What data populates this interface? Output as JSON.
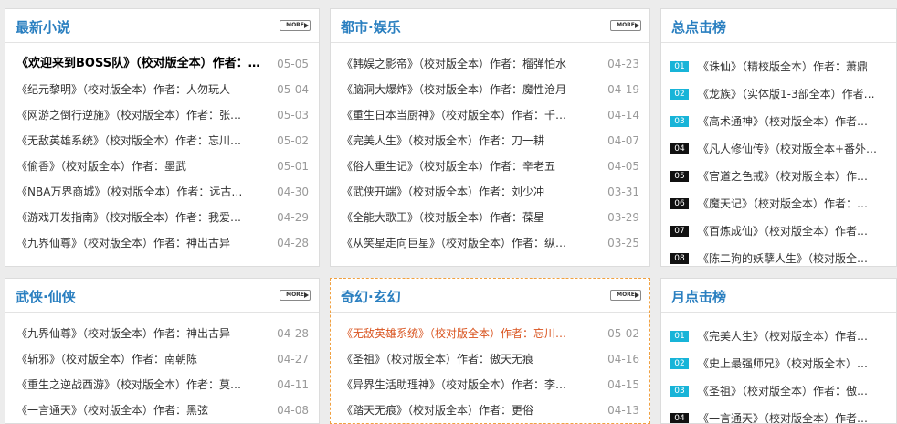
{
  "more_label": "MORE",
  "latest": {
    "title": "最新小说",
    "items": [
      {
        "text": "《欢迎来到BOSS队》（校对版全本）作者：…",
        "date": "05-05"
      },
      {
        "text": "《纪元黎明》（校对版全本）作者：人勿玩人",
        "date": "05-04"
      },
      {
        "text": "《网游之倒行逆施》（校对版全本）作者：张…",
        "date": "05-03"
      },
      {
        "text": "《无敌英雄系统》（校对版全本）作者：忘川…",
        "date": "05-02"
      },
      {
        "text": "《偷香》（校对版全本）作者：墨武",
        "date": "05-01"
      },
      {
        "text": "《NBA万界商城》（校对版全本）作者：远古…",
        "date": "04-30"
      },
      {
        "text": "《游戏开发指南》（校对版全本）作者：我爱…",
        "date": "04-29"
      },
      {
        "text": "《九界仙尊》（校对版全本）作者：神出古异",
        "date": "04-28"
      }
    ]
  },
  "urban": {
    "title": "都市·娱乐",
    "items": [
      {
        "text": "《韩娱之影帝》（校对版全本）作者：榴弹怕水",
        "date": "04-23"
      },
      {
        "text": "《脑洞大爆炸》（校对版全本）作者：魔性沧月",
        "date": "04-19"
      },
      {
        "text": "《重生日本当厨神》（校对版全本）作者：千…",
        "date": "04-14"
      },
      {
        "text": "《完美人生》（校对版全本）作者：刀一耕",
        "date": "04-07"
      },
      {
        "text": "《俗人重生记》（校对版全本）作者：辛老五",
        "date": "04-05"
      },
      {
        "text": "《武侠开端》（校对版全本）作者：刘少冲",
        "date": "03-31"
      },
      {
        "text": "《全能大歌王》（校对版全本）作者：葆星",
        "date": "03-29"
      },
      {
        "text": "《从笑星走向巨星》（校对版全本）作者：纵…",
        "date": "03-25"
      }
    ]
  },
  "total": {
    "title": "总点击榜",
    "items": [
      {
        "rank": "01",
        "text": "《诛仙》（精校版全本）作者：萧鼎"
      },
      {
        "rank": "02",
        "text": "《龙族》（实体版1-3部全本）作者…"
      },
      {
        "rank": "03",
        "text": "《高术通神》（校对版全本）作者…"
      },
      {
        "rank": "04",
        "text": "《凡人修仙传》（校对版全本+番外…"
      },
      {
        "rank": "05",
        "text": "《官道之色戒》（校对版全本）作…"
      },
      {
        "rank": "06",
        "text": "《魔天记》（校对版全本）作者：…"
      },
      {
        "rank": "07",
        "text": "《百炼成仙》（校对版全本）作者…"
      },
      {
        "rank": "08",
        "text": "《陈二狗的妖孽人生》（校对版全…"
      }
    ]
  },
  "wuxia": {
    "title": "武侠·仙侠",
    "items": [
      {
        "text": "《九界仙尊》（校对版全本）作者：神出古异",
        "date": "04-28"
      },
      {
        "text": "《斩邪》（校对版全本）作者：南朝陈",
        "date": "04-27"
      },
      {
        "text": "《重生之逆战西游》（校对版全本）作者：莫…",
        "date": "04-11"
      },
      {
        "text": "《一言通天》（校对版全本）作者：黑弦",
        "date": "04-08"
      }
    ]
  },
  "fantasy": {
    "title": "奇幻·玄幻",
    "items": [
      {
        "text": "《无敌英雄系统》（校对版全本）作者：忘川…",
        "date": "05-02"
      },
      {
        "text": "《圣祖》（校对版全本）作者：傲天无痕",
        "date": "04-16"
      },
      {
        "text": "《异界生活助理神》（校对版全本）作者：李…",
        "date": "04-15"
      },
      {
        "text": "《踏天无痕》（校对版全本）作者：更俗",
        "date": "04-13"
      }
    ]
  },
  "monthly": {
    "title": "月点击榜",
    "items": [
      {
        "rank": "01",
        "text": "《完美人生》（校对版全本）作者…"
      },
      {
        "rank": "02",
        "text": "《史上最强师兄》（校对版全本）…"
      },
      {
        "rank": "03",
        "text": "《圣祖》（校对版全本）作者：傲…"
      },
      {
        "rank": "04",
        "text": "《一言通天》（校对版全本）作者…"
      }
    ]
  },
  "colors": {
    "title": "#2a7fc0",
    "rank_top": "#18b4d8",
    "rank_other": "#111111",
    "highlight": "#d9531e",
    "dashed_border": "#f0a040"
  }
}
